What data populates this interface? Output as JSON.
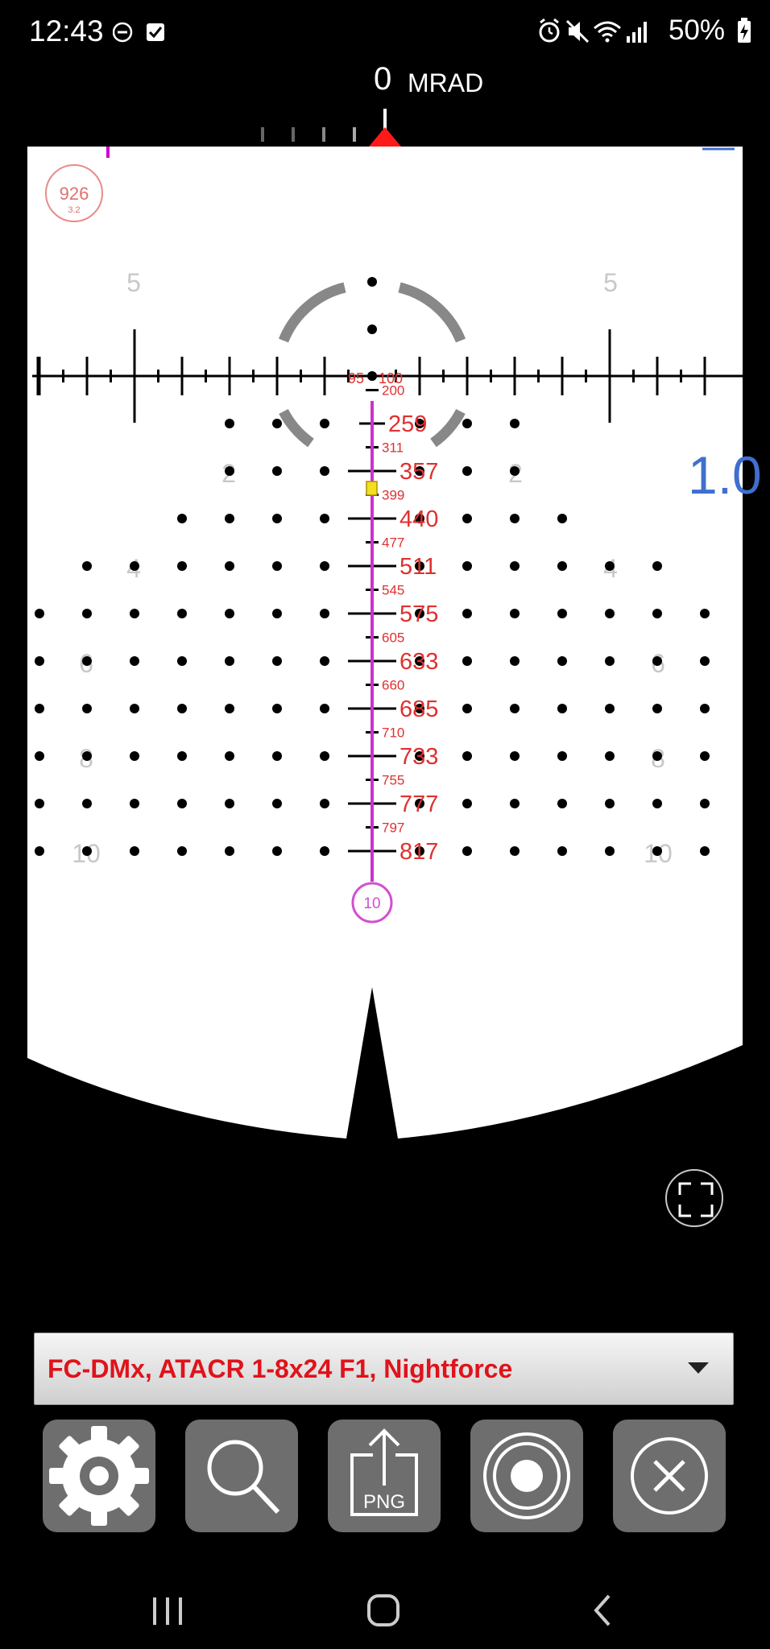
{
  "status_bar": {
    "time": "12:43",
    "battery_percent": "50%",
    "left_icons": [
      "do-not-disturb-icon",
      "checkbox-notification-icon"
    ],
    "right_icons": [
      "alarm-icon",
      "mute-icon",
      "wifi-icon",
      "signal-icon",
      "battery-charging-icon"
    ]
  },
  "windage": {
    "value": "0",
    "unit": "MRAD"
  },
  "reticle": {
    "range_badge": {
      "value": "926",
      "sub": "3.2"
    },
    "side_value": "1.0",
    "crosshair_labels": {
      "left": "95",
      "right": "100"
    },
    "hold_number_labels": {
      "top_left": "5",
      "top_right": "5",
      "row2_left": "2",
      "row2_right": "2",
      "row4_left": "4",
      "row4_right": "4",
      "row6_left": "6",
      "row6_right": "6",
      "row8_left": "8",
      "row8_right": "8",
      "row10_left": "10",
      "row10_right": "10"
    },
    "bdc_major": [
      "259",
      "357",
      "440",
      "511",
      "575",
      "633",
      "685",
      "733",
      "777",
      "817"
    ],
    "bdc_minor": [
      "200",
      "311",
      "399",
      "477",
      "545",
      "605",
      "660",
      "710",
      "755",
      "797"
    ],
    "bottom_marker": "10"
  },
  "colors": {
    "bdc_red": "#e03030",
    "trajectory_magenta": "#cc33cc",
    "side_value_blue": "#3f6fcf",
    "label_gray": "#c8c8c8",
    "dropdown_text": "#e0121b"
  },
  "selector": {
    "label": "FC-DMx, ATACR 1-8x24 F1, Nightforce"
  },
  "toolbar": {
    "buttons": [
      {
        "name": "settings",
        "icon": "gear-icon"
      },
      {
        "name": "zoom",
        "icon": "search-icon"
      },
      {
        "name": "export-png",
        "icon": "export-png-icon",
        "label": "PNG"
      },
      {
        "name": "target",
        "icon": "target-icon"
      },
      {
        "name": "close",
        "icon": "close-circle-icon"
      }
    ]
  },
  "nav": {
    "buttons": [
      "recent-apps-icon",
      "home-icon",
      "back-icon"
    ]
  }
}
